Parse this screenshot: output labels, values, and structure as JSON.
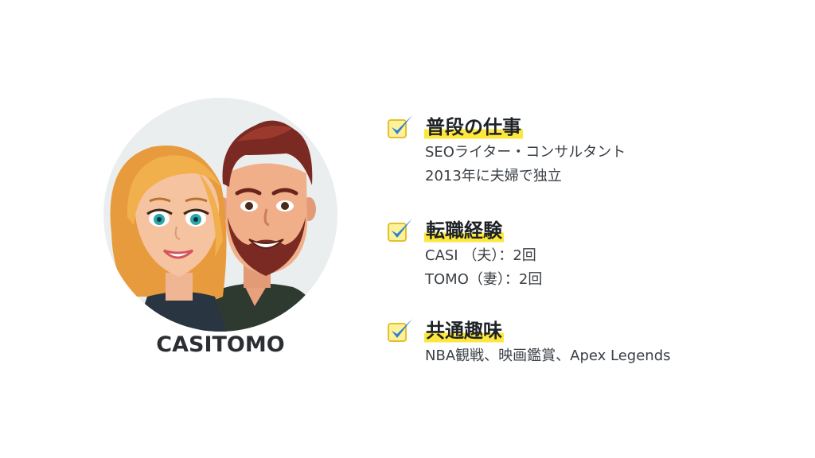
{
  "profile": {
    "name": "CASITOMO",
    "avatar_icon": "couple-avatar-illustration"
  },
  "colors": {
    "highlight": "#fde73d",
    "check_box_fill": "#fdf19a",
    "check_mark": "#2f7fd0",
    "avatar_bg": "#eaeeef"
  },
  "sections": [
    {
      "icon": "checkbox-checked-icon",
      "title": "普段の仕事",
      "lines": [
        "SEOライター・コンサルタント",
        "2013年に夫婦で独立"
      ]
    },
    {
      "icon": "checkbox-checked-icon",
      "title": "転職経験",
      "lines": [
        "CASI （夫）：2回",
        "TOMO（妻）：2回"
      ]
    },
    {
      "icon": "checkbox-checked-icon",
      "title": "共通趣味",
      "lines": [
        "NBA観戦、映画鑑賞、Apex Legends"
      ]
    }
  ]
}
